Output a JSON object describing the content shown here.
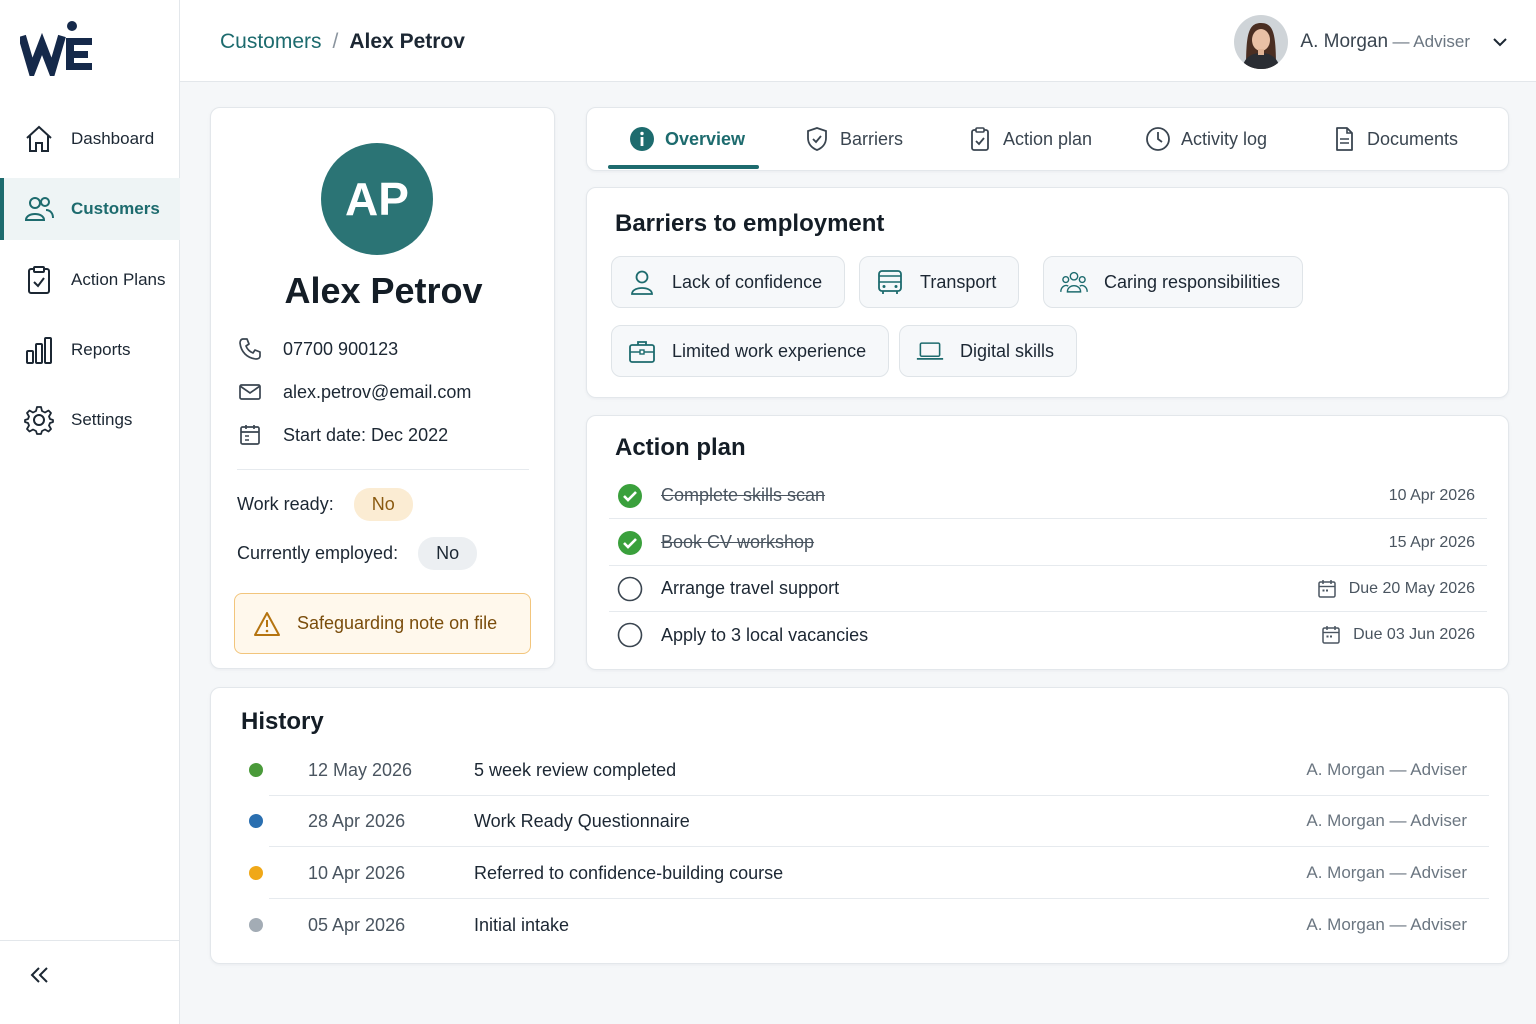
{
  "brand": {
    "logo_text": "WE"
  },
  "sidebar": {
    "items": [
      {
        "label": "Dashboard",
        "icon": "home-icon",
        "active": false
      },
      {
        "label": "Customers",
        "icon": "users-icon",
        "active": true
      },
      {
        "label": "Action Plans",
        "icon": "clipboard-icon",
        "active": false
      },
      {
        "label": "Reports",
        "icon": "bar-chart-icon",
        "active": false
      },
      {
        "label": "Settings",
        "icon": "gear-icon",
        "active": false
      }
    ],
    "collapse_icon": "double-chevron-left-icon"
  },
  "header": {
    "breadcrumb": {
      "parent": "Customers",
      "separator": "/",
      "current": "Alex Petrov"
    },
    "user": {
      "name": "A. Morgan",
      "role": "— Adviser"
    }
  },
  "profile": {
    "initials": "AP",
    "name": "Alex Petrov",
    "phone": "07700 900123",
    "email": "alex.petrov@email.com",
    "start_date": "Start date: Dec 2022",
    "work_ready_label": "Work ready:",
    "work_ready_value": "No",
    "employed_label": "Currently employed:",
    "employed_value": "No",
    "safeguarding": "Safeguarding note on file"
  },
  "tabs": [
    {
      "label": "Overview",
      "icon": "info-icon",
      "active": true
    },
    {
      "label": "Barriers",
      "icon": "shield-icon",
      "active": false
    },
    {
      "label": "Action plan",
      "icon": "clipboard-check-icon",
      "active": false
    },
    {
      "label": "Activity log",
      "icon": "clock-icon",
      "active": false
    },
    {
      "label": "Documents",
      "icon": "document-icon",
      "active": false
    }
  ],
  "barriers": {
    "title": "Barriers to employment",
    "items": [
      {
        "label": "Lack of confidence",
        "icon": "person-icon"
      },
      {
        "label": "Transport",
        "icon": "bus-icon"
      },
      {
        "label": "Caring responsibilities",
        "icon": "group-icon"
      },
      {
        "label": "Limited work experience",
        "icon": "briefcase-icon"
      },
      {
        "label": "Digital skills",
        "icon": "laptop-icon"
      }
    ]
  },
  "action_plan": {
    "title": "Action plan",
    "items": [
      {
        "label": "Complete skills scan",
        "date": "10 Apr 2026",
        "done": true
      },
      {
        "label": "Book CV workshop",
        "date": "15 Apr 2026",
        "done": true
      },
      {
        "label": "Arrange travel support",
        "date": "Due 20 May 2026",
        "done": false
      },
      {
        "label": "Apply to 3 local vacancies",
        "date": "Due 03 Jun 2026",
        "done": false
      }
    ]
  },
  "history": {
    "title": "History",
    "items": [
      {
        "date": "12 May 2026",
        "event": "5 week review completed",
        "by": "A. Morgan — Adviser",
        "color": "#4a9a3a"
      },
      {
        "date": "28 Apr 2026",
        "event": "Work Ready Questionnaire",
        "by": "A. Morgan — Adviser",
        "color": "#2a6fb0"
      },
      {
        "date": "10 Apr 2026",
        "event": "Referred to confidence-building course",
        "by": "A. Morgan — Adviser",
        "color": "#f0a818"
      },
      {
        "date": "05 Apr 2026",
        "event": "Initial intake",
        "by": "A. Morgan — Adviser",
        "color": "#a3acb5"
      }
    ]
  },
  "colors": {
    "accent": "#1d6b6e",
    "warning_bg": "#fff8ec",
    "warning_border": "#f2c57c"
  }
}
